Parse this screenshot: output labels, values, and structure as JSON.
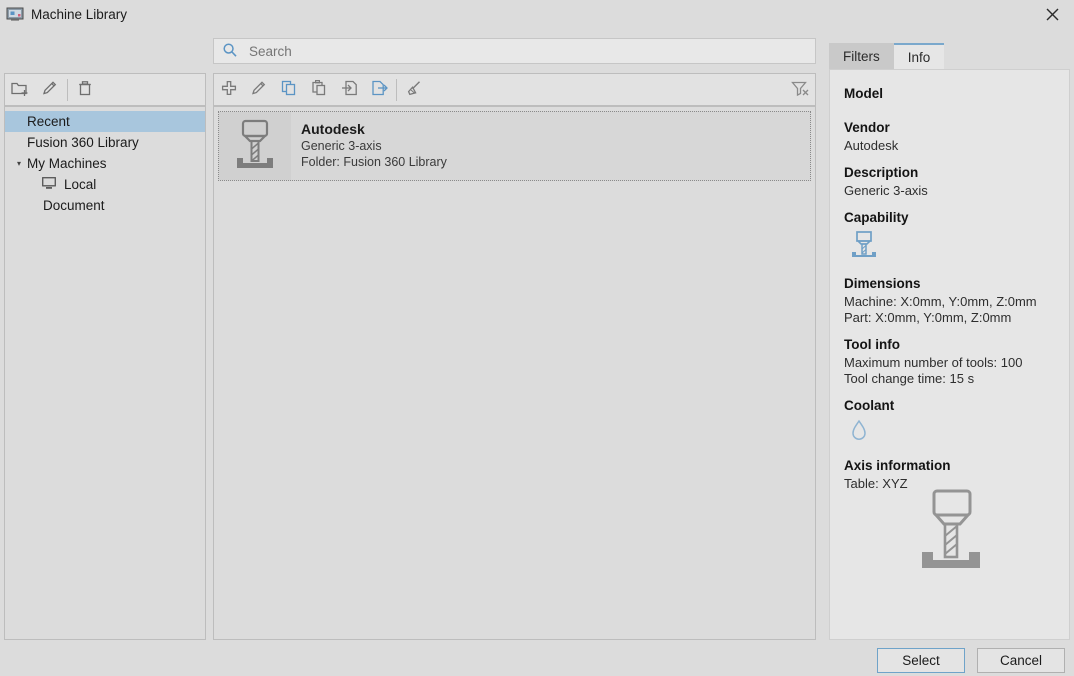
{
  "window": {
    "title": "Machine Library",
    "icon": "machine-icon",
    "close_icon": "close-icon"
  },
  "left_toolbar": {
    "buttons": [
      {
        "name": "new-folder-button",
        "icon": "new-folder-icon"
      },
      {
        "name": "edit-button",
        "icon": "pencil-icon"
      },
      {
        "name": "delete-button",
        "icon": "trash-icon"
      }
    ]
  },
  "tree": {
    "items": [
      {
        "label": "Recent",
        "selected": true,
        "level": 0,
        "arrow": "",
        "icon": ""
      },
      {
        "label": "Fusion 360 Library",
        "selected": false,
        "level": 0,
        "arrow": "",
        "icon": ""
      },
      {
        "label": "My Machines",
        "selected": false,
        "level": 0,
        "arrow": "▾",
        "icon": ""
      },
      {
        "label": "Local",
        "selected": false,
        "level": 1,
        "arrow": "",
        "icon": "monitor-icon"
      },
      {
        "label": "Document",
        "selected": false,
        "level": 1,
        "arrow": "",
        "icon": ""
      }
    ]
  },
  "search": {
    "placeholder": "Search",
    "value": "",
    "icon": "search-icon"
  },
  "center_toolbar": {
    "buttons": [
      {
        "name": "add-machine-button",
        "icon": "plus-icon"
      },
      {
        "name": "edit-machine-button",
        "icon": "pencil-icon"
      },
      {
        "name": "copy-button",
        "icon": "copy-icon"
      },
      {
        "name": "paste-button",
        "icon": "paste-icon"
      },
      {
        "name": "import-button",
        "icon": "import-icon"
      },
      {
        "name": "export-button",
        "icon": "export-icon"
      },
      {
        "name": "post-process-button",
        "icon": "broom-icon"
      }
    ],
    "clear_filter": {
      "name": "clear-filter-button",
      "icon": "filter-clear-icon"
    }
  },
  "list": {
    "items": [
      {
        "title": "Autodesk",
        "description": "Generic 3-axis",
        "folder": "Folder: Fusion 360 Library",
        "icon": "mill-machine-icon",
        "selected": true
      }
    ]
  },
  "right_panel": {
    "tabs": [
      {
        "label": "Filters",
        "active": false
      },
      {
        "label": "Info",
        "active": true
      }
    ],
    "sections": {
      "model_heading": "Model",
      "model_value": "",
      "vendor_heading": "Vendor",
      "vendor_value": "Autodesk",
      "description_heading": "Description",
      "description_value": "Generic 3-axis",
      "capability_heading": "Capability",
      "capability_icon": "mill-capability-icon",
      "dimensions_heading": "Dimensions",
      "dimensions_machine": "Machine: X:0mm, Y:0mm, Z:0mm",
      "dimensions_part": "Part: X:0mm, Y:0mm, Z:0mm",
      "tool_info_heading": "Tool info",
      "tool_info_max": "Maximum number of tools: 100",
      "tool_info_change": "Tool change time: 15 s",
      "coolant_heading": "Coolant",
      "coolant_icon": "coolant-drop-icon",
      "axis_heading": "Axis information",
      "axis_value": "Table: XYZ",
      "preview_icon": "mill-machine-preview-icon"
    }
  },
  "footer": {
    "select_label": "Select",
    "cancel_label": "Cancel"
  },
  "colors": {
    "accent_blue": "#6fa3c9",
    "icon_blue": "#5b94c4",
    "selection_blue": "#a8c6dd",
    "window_bg": "#dcdcdc",
    "panel_bg": "#e6e6e6",
    "icon_gray": "#8a8a8a"
  }
}
